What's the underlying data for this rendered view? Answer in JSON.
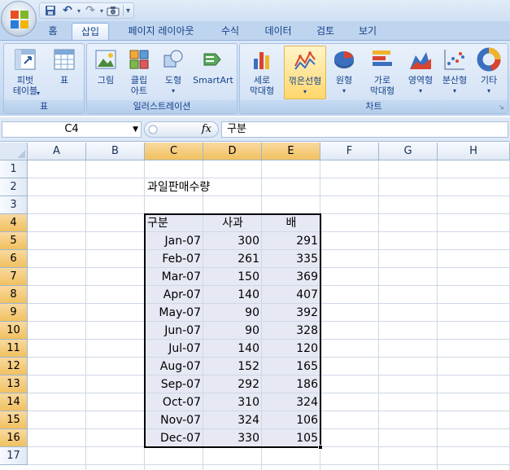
{
  "quick_access": {
    "undo_label": "↶",
    "redo_label": "↷"
  },
  "tabs": [
    {
      "label": "홈"
    },
    {
      "label": "삽입"
    },
    {
      "label": "페이지 레이아웃"
    },
    {
      "label": "수식"
    },
    {
      "label": "데이터"
    },
    {
      "label": "검토"
    },
    {
      "label": "보기"
    }
  ],
  "ribbon": {
    "groups": [
      {
        "label": "표",
        "buttons": [
          {
            "label": "피벗\n테이블"
          },
          {
            "label": "표"
          }
        ]
      },
      {
        "label": "일러스트레이션",
        "buttons": [
          {
            "label": "그림"
          },
          {
            "label": "클립\n아트"
          },
          {
            "label": "도형"
          },
          {
            "label": "SmartArt"
          }
        ]
      },
      {
        "label": "차트",
        "buttons": [
          {
            "label": "세로\n막대형"
          },
          {
            "label": "꺾은선형"
          },
          {
            "label": "원형"
          },
          {
            "label": "가로\n막대형"
          },
          {
            "label": "영역형"
          },
          {
            "label": "분산형"
          },
          {
            "label": "기타"
          }
        ]
      }
    ]
  },
  "formula_bar": {
    "name_box": "C4",
    "fx": "fx",
    "formula": "구분"
  },
  "columns": [
    "A",
    "B",
    "C",
    "D",
    "E",
    "F",
    "G",
    "H"
  ],
  "rows": [
    "1",
    "2",
    "3",
    "4",
    "5",
    "6",
    "7",
    "8",
    "9",
    "10",
    "11",
    "12",
    "13",
    "14",
    "15",
    "16",
    "17"
  ],
  "sheet": {
    "title": "과일판매수량",
    "headers": [
      "구분",
      "사과",
      "배"
    ],
    "data": [
      [
        "Jan-07",
        "300",
        "291"
      ],
      [
        "Feb-07",
        "261",
        "335"
      ],
      [
        "Mar-07",
        "150",
        "369"
      ],
      [
        "Apr-07",
        "140",
        "407"
      ],
      [
        "May-07",
        "90",
        "392"
      ],
      [
        "Jun-07",
        "90",
        "328"
      ],
      [
        "Jul-07",
        "140",
        "120"
      ],
      [
        "Aug-07",
        "152",
        "165"
      ],
      [
        "Sep-07",
        "292",
        "186"
      ],
      [
        "Oct-07",
        "310",
        "324"
      ],
      [
        "Nov-07",
        "324",
        "106"
      ],
      [
        "Dec-07",
        "330",
        "105"
      ]
    ]
  },
  "colors": {
    "ribbon_accent": "#15428b",
    "selected_header": "#f1c15f",
    "selection_fill": "#e6e9f4"
  }
}
